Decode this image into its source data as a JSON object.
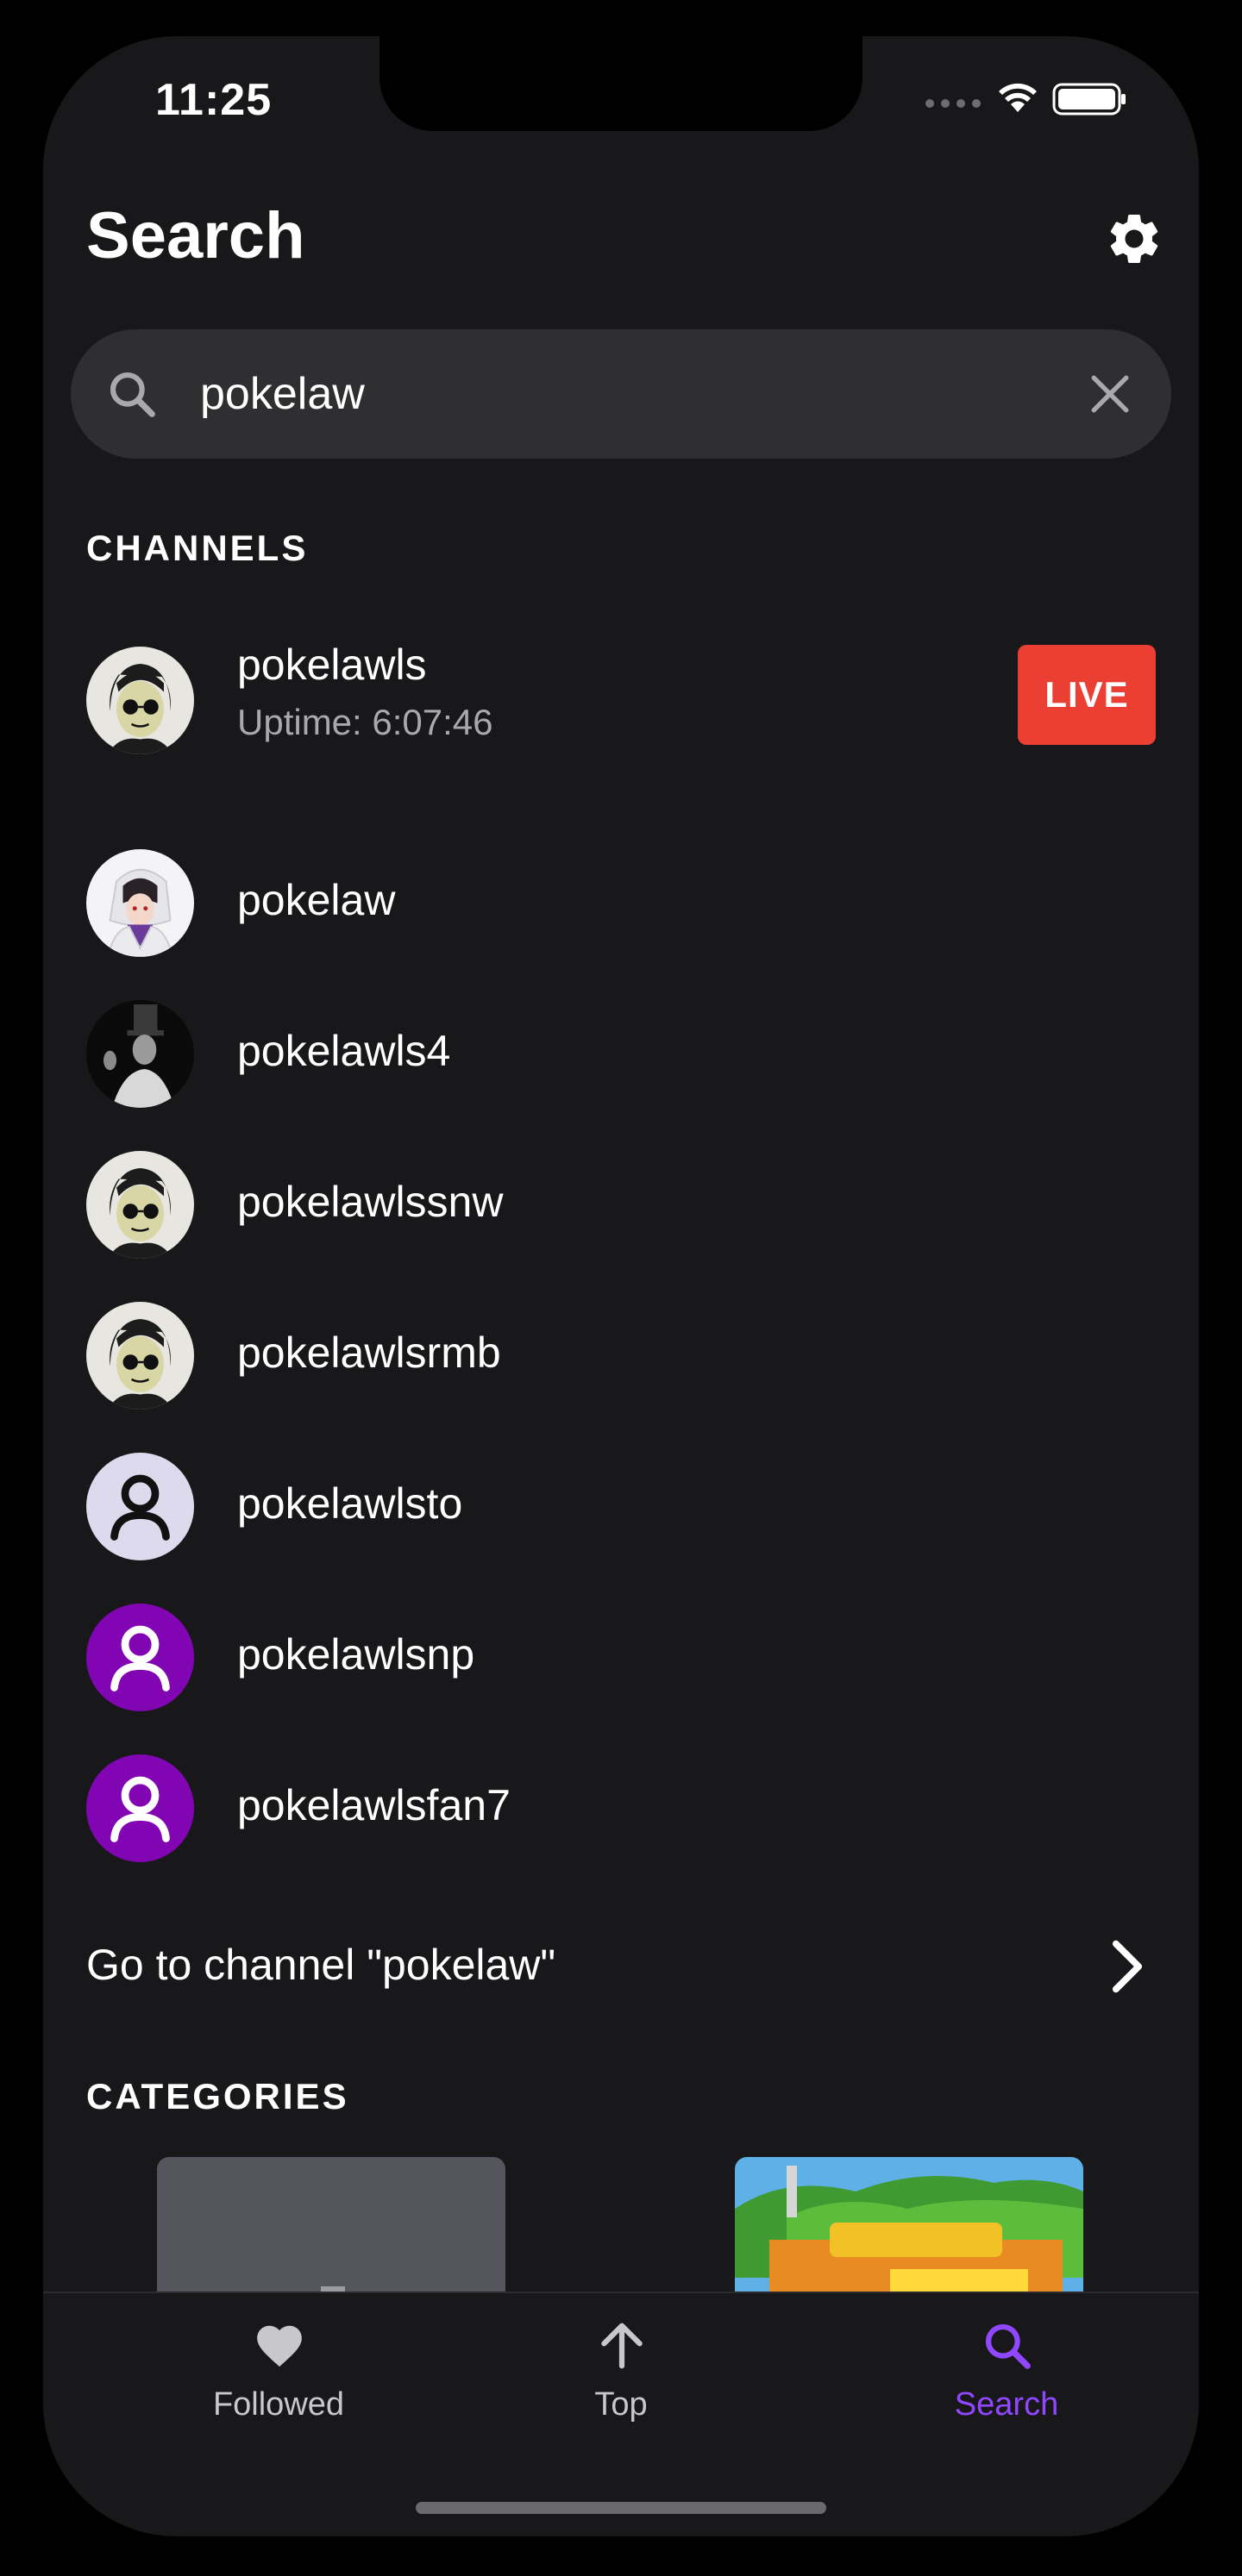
{
  "status_bar": {
    "time": "11:25"
  },
  "header": {
    "title": "Search"
  },
  "search": {
    "value": "pokelaw"
  },
  "channels": {
    "section_title": "CHANNELS",
    "items": [
      {
        "name": "pokelawls",
        "uptime": "Uptime: 6:07:46",
        "live_badge": "LIVE",
        "avatar": "cartoon-sunglasses"
      },
      {
        "name": "pokelaw",
        "avatar": "anime-character"
      },
      {
        "name": "pokelawls4",
        "avatar": "photo-tophat"
      },
      {
        "name": "pokelawlssnw",
        "avatar": "cartoon-sunglasses"
      },
      {
        "name": "pokelawlsrmb",
        "avatar": "cartoon-sunglasses"
      },
      {
        "name": "pokelawlsto",
        "avatar": "default-user-light"
      },
      {
        "name": "pokelawlsnp",
        "avatar": "default-user-purple"
      },
      {
        "name": "pokelawlsfan7",
        "avatar": "default-user-purple"
      }
    ],
    "goto_label": "Go to channel \"pokelaw\""
  },
  "categories": {
    "section_title": "CATEGORIES"
  },
  "tabbar": {
    "tabs": [
      {
        "label": "Followed",
        "icon": "heart-icon"
      },
      {
        "label": "Top",
        "icon": "arrow-up-icon"
      },
      {
        "label": "Search",
        "icon": "search-icon",
        "active": true
      }
    ]
  },
  "colors": {
    "background": "#18181a",
    "accent": "#9147ff",
    "live": "#eb3f33",
    "search_bar": "#2f2f32",
    "avatar_purple": "#8205b4"
  }
}
